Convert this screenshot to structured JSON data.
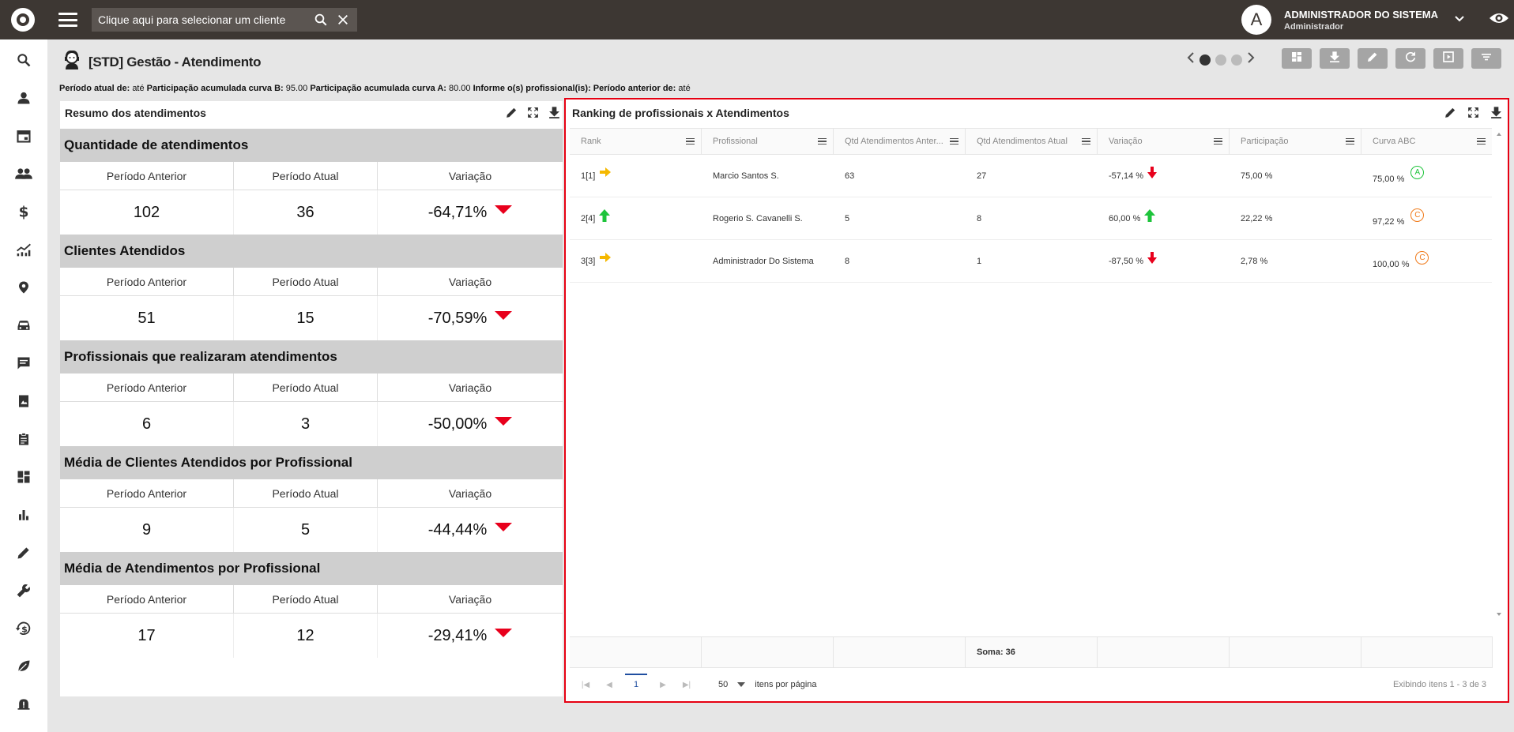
{
  "topbar": {
    "search_placeholder": "Clique aqui para selecionar um cliente",
    "user_initial": "A",
    "user_name": "ADMINISTRADOR DO SISTEMA",
    "user_role": "Administrador"
  },
  "page": {
    "title": "[STD] Gestão - Atendimento",
    "params": [
      {
        "label": "Período atual de:",
        "value": "até"
      },
      {
        "label": "Participação acumulada curva B:",
        "value": "95.00"
      },
      {
        "label": "Participação acumulada curva A:",
        "value": "80.00"
      },
      {
        "label": "Informe o(s) profissional(is):",
        "value": ""
      },
      {
        "label": "Período anterior de:",
        "value": "até"
      }
    ]
  },
  "summary": {
    "title": "Resumo dos atendimentos",
    "col_prev": "Período Anterior",
    "col_curr": "Período Atual",
    "col_var": "Variação",
    "metrics": [
      {
        "title": "Quantidade de atendimentos",
        "prev": "102",
        "curr": "36",
        "var": "-64,71%"
      },
      {
        "title": "Clientes Atendidos",
        "prev": "51",
        "curr": "15",
        "var": "-70,59%"
      },
      {
        "title": "Profissionais que realizaram atendimentos",
        "prev": "6",
        "curr": "3",
        "var": "-50,00%"
      },
      {
        "title": "Média de Clientes Atendidos por Profissional",
        "prev": "9",
        "curr": "5",
        "var": "-44,44%"
      },
      {
        "title": "Média de Atendimentos por Profissional",
        "prev": "17",
        "curr": "12",
        "var": "-29,41%"
      }
    ]
  },
  "ranking": {
    "title": "Ranking de profissionais x Atendimentos",
    "columns": [
      "Rank",
      "Profissional",
      "Qtd Atendimentos Anter...",
      "Qtd Atendimentos Atual",
      "Variação",
      "Participação",
      "Curva ABC"
    ],
    "rows": [
      {
        "rank": "1[1]",
        "trend": "same",
        "profissional": "Marcio Santos S.",
        "anterior": "63",
        "atual": "27",
        "variacao": "-57,14 %",
        "var_dir": "down",
        "participacao": "75,00 %",
        "acumulado": "75,00 %",
        "curva": "A"
      },
      {
        "rank": "2[4]",
        "trend": "up",
        "profissional": "Rogerio S. Cavanelli S.",
        "anterior": "5",
        "atual": "8",
        "variacao": "60,00 %",
        "var_dir": "up",
        "participacao": "22,22 %",
        "acumulado": "97,22 %",
        "curva": "C"
      },
      {
        "rank": "3[3]",
        "trend": "same",
        "profissional": "Administrador Do Sistema",
        "anterior": "8",
        "atual": "1",
        "variacao": "-87,50 %",
        "var_dir": "down",
        "participacao": "2,78 %",
        "acumulado": "100,00 %",
        "curva": "C"
      }
    ],
    "footer_sum": "Soma: 36",
    "pager": {
      "current_page": "1",
      "page_size": "50",
      "page_size_label": "itens por página",
      "info": "Exibindo itens 1 - 3 de 3"
    }
  },
  "colors": {
    "topbar": "#3d3733",
    "highlight_border": "#e60012",
    "down": "#e8001c",
    "up": "#1ec43b",
    "same": "#f5b800",
    "curve_a": "#1ec43b",
    "curve_c": "#f07a1a"
  }
}
